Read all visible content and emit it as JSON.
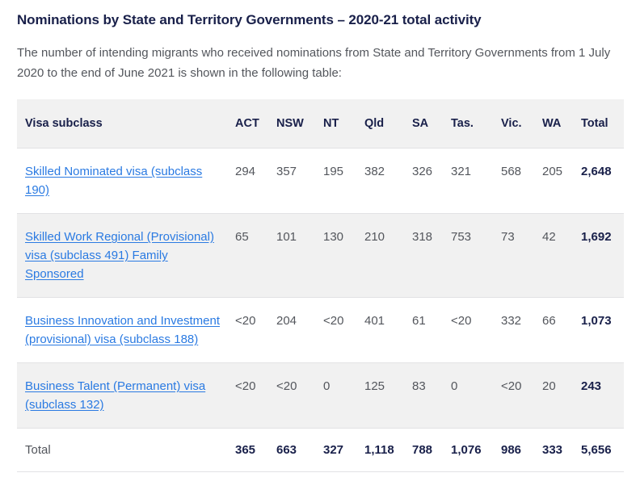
{
  "header": {
    "title": "Nominations by State and Territory Governments – 2020-21 total activity",
    "intro": "The number of intending migrants who received nominations from State and Territory Governments from 1 July 2020 to the end of June 2021 is shown in the following table:"
  },
  "colors": {
    "link": "#2a7ae2",
    "heading": "#19204a",
    "body_text": "#53565c",
    "row_shade": "#f1f1f1",
    "border": "#e2e2e4"
  },
  "table": {
    "columns": [
      {
        "key": "label",
        "label": "Visa subclass"
      },
      {
        "key": "act",
        "label": "ACT"
      },
      {
        "key": "nsw",
        "label": "NSW"
      },
      {
        "key": "nt",
        "label": "NT"
      },
      {
        "key": "qld",
        "label": "Qld"
      },
      {
        "key": "sa",
        "label": "SA"
      },
      {
        "key": "tas",
        "label": "Tas."
      },
      {
        "key": "vic",
        "label": "Vic."
      },
      {
        "key": "wa",
        "label": "WA"
      },
      {
        "key": "total",
        "label": "Total"
      }
    ],
    "rows": [
      {
        "label": "Skilled Nominated visa (subclass 190)",
        "is_link": true,
        "values": [
          "294",
          "357",
          "195",
          "382",
          "326",
          "321",
          "568",
          "205"
        ],
        "total": "2,648"
      },
      {
        "label": "Skilled Work Regional (Provisional) visa (subclass 491) Family Sponsored",
        "is_link": true,
        "values": [
          "65",
          "101",
          "130",
          "210",
          "318",
          "753",
          "73",
          "42"
        ],
        "total": "1,692"
      },
      {
        "label": "Business Innovation and Investment (provisional) visa (subclass 188)",
        "is_link": true,
        "values": [
          "<20",
          "204",
          "<20",
          "401",
          "61",
          "<20",
          "332",
          "66"
        ],
        "total": "1,073"
      },
      {
        "label": "Business Talent (Permanent) visa (subclass 132)",
        "is_link": true,
        "values": [
          "<20",
          "<20",
          "0",
          "125",
          "83",
          "0",
          "<20",
          "20"
        ],
        "total": "243"
      }
    ],
    "footer": {
      "label": "Total",
      "values": [
        "365",
        "663",
        "327",
        "1,118",
        "788",
        "1,076",
        "986",
        "333"
      ],
      "total": "5,656"
    }
  }
}
